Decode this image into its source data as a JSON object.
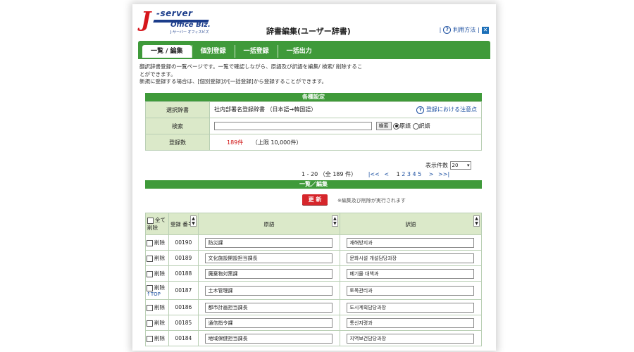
{
  "logo": {
    "text_j": "J",
    "text_server": "-server",
    "text_office": "Office Biz.",
    "text_sub": "J-サーバー オフィスビズ"
  },
  "title": "辞書編集(ユーザー辞書)",
  "help": {
    "label": "利用方法",
    "sep": "|"
  },
  "tabs": [
    {
      "label": "一覧 / 編集",
      "active": true
    },
    {
      "label": "個別登録",
      "active": false
    },
    {
      "label": "一括登録",
      "active": false
    },
    {
      "label": "一括出力",
      "active": false
    }
  ],
  "intro": {
    "line1": "翻訳辞書登録の一覧ページです。一覧で確認しながら、原語及び訳語を編集/ 検索/ 削除するこ",
    "line2": "とができます。",
    "line3": "新規に登録する場合は、[個別登録]か[一括登録]から登録することができます。"
  },
  "settings": {
    "header": "各種設定",
    "dict_label": "選択辞書",
    "dict_value": "社内部署名登録辞書 （日本語→韓国語）",
    "dict_note": "登録における注意点",
    "search_label": "検索",
    "search_value": "",
    "search_button": "検索",
    "radio_source": "原語",
    "radio_target": "訳語",
    "count_label": "登録数",
    "count_value": "189件",
    "count_limit": "（上限 10,000件）"
  },
  "pager": {
    "per_page_label": "表示件数",
    "per_page_value": "20",
    "range": "1 - 20 （全 189 件）",
    "first": "|<<",
    "prev": "<",
    "pages": [
      "1",
      "2",
      "3",
      "4",
      "5"
    ],
    "next": ">",
    "last": ">>|"
  },
  "list": {
    "header": "一覧／編集",
    "update_button": "更 新",
    "update_note": "※編集及び削除が実行されます",
    "col_all_delete": "全て 削除",
    "col_number": "登録 番号",
    "col_source": "原語",
    "col_target": "訳語",
    "delete_label": "削除",
    "top_link": "↑TOP",
    "rows": [
      {
        "number": "00190",
        "source": "防災課",
        "target": "재해방지과"
      },
      {
        "number": "00189",
        "source": "文化施設開設担当課長",
        "target": "문화시설 개설담당과장"
      },
      {
        "number": "00188",
        "source": "廃棄物対策課",
        "target": "폐기물 대책과"
      },
      {
        "number": "00187",
        "source": "土木管理課",
        "target": "토목관리과"
      },
      {
        "number": "00186",
        "source": "都市計画担当課長",
        "target": "도시계획담당과장"
      },
      {
        "number": "00185",
        "source": "通信指令課",
        "target": "통신지령과"
      },
      {
        "number": "00184",
        "source": "地域保健担当課長",
        "target": "지역보건담당과장"
      }
    ]
  },
  "colors": {
    "green": "#3f9a3a",
    "light_green": "#dbe9c9",
    "red": "#d6262b",
    "blue": "#1b4fa0"
  }
}
